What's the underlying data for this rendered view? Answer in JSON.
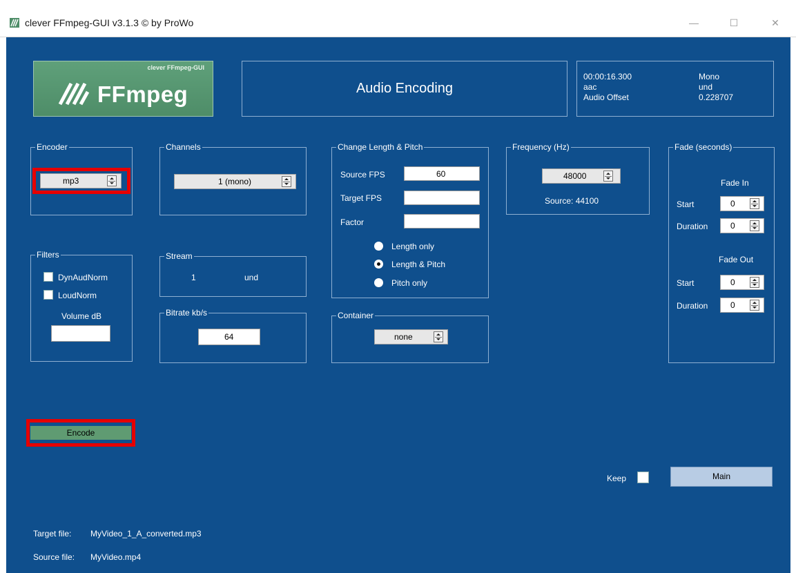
{
  "window": {
    "title": "clever FFmpeg-GUI v3.1.3  © by ProWo",
    "minimize": "—",
    "maximize": "☐",
    "close": "✕"
  },
  "logo": {
    "small": "clever FFmpeg-GUI",
    "big": "FFmpeg"
  },
  "mode_title": "Audio Encoding",
  "info": {
    "duration": "00:00:16.300",
    "codec": "aac",
    "audio_offset_label": "Audio Offset",
    "channel_mode": "Mono",
    "language": "und",
    "audio_offset_value": "0.228707"
  },
  "encoder": {
    "legend": "Encoder",
    "value": "mp3"
  },
  "channels": {
    "legend": "Channels",
    "value": "1 (mono)"
  },
  "change_length": {
    "legend": "Change Length & Pitch",
    "source_fps_label": "Source FPS",
    "source_fps_value": "60",
    "target_fps_label": "Target FPS",
    "target_fps_value": "",
    "factor_label": "Factor",
    "factor_value": "",
    "options": [
      "Length only",
      "Length & Pitch",
      "Pitch only"
    ],
    "selected": "Length & Pitch"
  },
  "frequency": {
    "legend": "Frequency (Hz)",
    "value": "48000",
    "source": "Source: 44100"
  },
  "fade": {
    "legend": "Fade (seconds)",
    "fade_in_label": "Fade In",
    "fade_out_label": "Fade Out",
    "start_label": "Start",
    "duration_label": "Duration",
    "in_start": "0",
    "in_duration": "0",
    "out_start": "0",
    "out_duration": "0"
  },
  "filters": {
    "legend": "Filters",
    "dynaudnorm": "DynAudNorm",
    "loudnorm": "LoudNorm",
    "volume_label": "Volume dB",
    "volume_value": ""
  },
  "stream": {
    "legend": "Stream",
    "index": "1",
    "language": "und"
  },
  "bitrate": {
    "legend": "Bitrate kb/s",
    "value": "64"
  },
  "container": {
    "legend": "Container",
    "value": "none"
  },
  "buttons": {
    "encode": "Encode",
    "main": "Main",
    "keep_label": "Keep"
  },
  "footer": {
    "target_label": "Target file:",
    "target_value": "MyVideo_1_A_converted.mp3",
    "source_label": "Source file:",
    "source_value": "MyVideo.mp4"
  },
  "colors": {
    "background": "#0f4f8d",
    "logo": "#5a9a74",
    "highlight": "#e60000",
    "main_button": "#b8cce4"
  }
}
